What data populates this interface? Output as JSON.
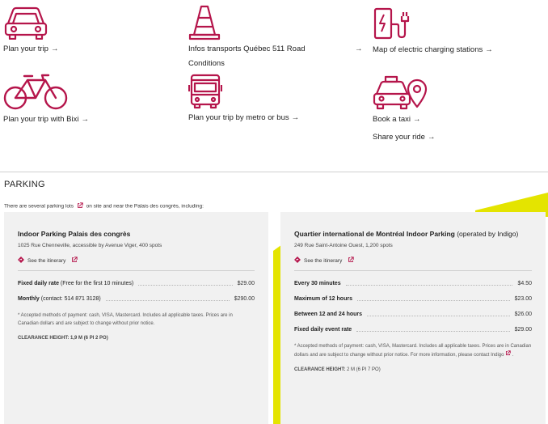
{
  "colors": {
    "accent": "#b5154b",
    "yellow": "#e4e400",
    "card_bg": "#f1f1f1"
  },
  "tiles": [
    {
      "icon": "car-icon",
      "label": "Plan your trip"
    },
    {
      "icon": "traffic-cone-icon",
      "label": "Infos transports Québec 511 Road Conditions"
    },
    {
      "icon": "ev-charging-icon",
      "label": "Map of electric charging stations"
    },
    {
      "icon": "bicycle-icon",
      "label": "Plan your trip with Bixi"
    },
    {
      "icon": "bus-icon",
      "label": "Plan your trip by metro or bus"
    },
    {
      "icon": "taxi-icon",
      "label": "Book a taxi"
    },
    {
      "label": "Share your ride"
    }
  ],
  "arrow": "→",
  "parking": {
    "heading": "PARKING",
    "intro_before": "There are several parking lots",
    "intro_after": "on site and near the Palais des congrès, including:",
    "cards": [
      {
        "title": "Indoor Parking Palais des congrès",
        "title_extra": "",
        "address": "1025 Rue Chenneville, accessible by Avenue Viger, 400 spots",
        "itinerary": "See the itinerary",
        "rates": [
          {
            "label": "Fixed daily rate",
            "sub": "(Free for the first 10 minutes)",
            "price": "$29.00"
          },
          {
            "label": "Monthly",
            "sub": "(contact: 514 871 3128)",
            "price": "$290.00"
          }
        ],
        "note": "* Accepted methods of payment: cash, VISA, Mastercard. Includes all applicable taxes. Prices are in Canadian dollars and are subject to change without prior notice.",
        "clearance_label": "CLEARANCE HEIGHT:",
        "clearance_value": "1,9 M (6 PI 2 PO)"
      },
      {
        "title": "Quartier international de Montréal Indoor Parking",
        "title_extra": "(operated by Indigo)",
        "address": "249 Rue Saint-Antoine Ouest, 1,200 spots",
        "itinerary": "See the itinerary",
        "rates": [
          {
            "label": "Every 30 minutes",
            "sub": "",
            "price": "$4.50"
          },
          {
            "label": "Maximum of 12 hours",
            "sub": "",
            "price": "$23.00"
          },
          {
            "label": "Between 12 and 24 hours",
            "sub": "",
            "price": "$26.00"
          },
          {
            "label": "Fixed daily event rate",
            "sub": "",
            "price": "$29.00"
          }
        ],
        "note": "* Accepted methods of payment: cash, VISA, Mastercard. Includes all applicable taxes. Prices are in Canadian dollars and are subject to change without prior notice. For more information, please contact Indigo",
        "clearance_label": "CLEARANCE HEIGHT:",
        "clearance_value": "2 M (6 PI 7 PO)"
      }
    ]
  }
}
